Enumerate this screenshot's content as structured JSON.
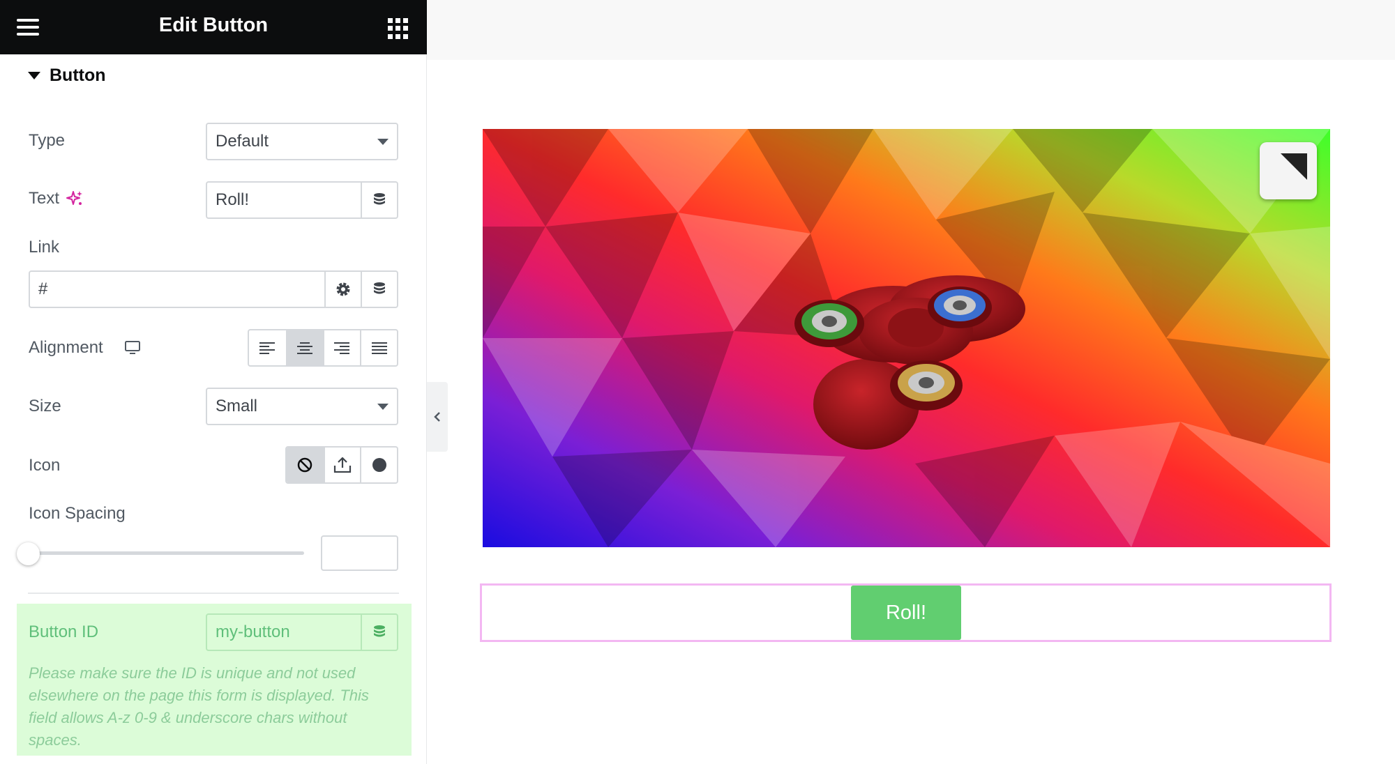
{
  "panel": {
    "title": "Edit Button",
    "section_title": "Button"
  },
  "controls": {
    "type": {
      "label": "Type",
      "value": "Default"
    },
    "text": {
      "label": "Text",
      "value": "Roll!"
    },
    "link": {
      "label": "Link",
      "value": "#"
    },
    "alignment": {
      "label": "Alignment",
      "options": [
        "left",
        "center",
        "right",
        "justify"
      ],
      "selected": "center"
    },
    "size": {
      "label": "Size",
      "value": "Small"
    },
    "icon": {
      "label": "Icon",
      "options": [
        "none",
        "upload",
        "circle"
      ],
      "selected": "none"
    },
    "icon_spacing": {
      "label": "Icon Spacing",
      "value": ""
    },
    "button_id": {
      "label": "Button ID",
      "value": "my-button",
      "help": "Please make sure the ID is unique and not used elsewhere on the page this form is displayed. This field allows A-z  0-9 & underscore chars without spaces."
    }
  },
  "canvas": {
    "button_label": "Roll!"
  },
  "colors": {
    "header_bg": "#0c0d0e",
    "accent_pink": "#d4249f",
    "button_green": "#61ce70",
    "selection_outline": "#f3b7f2",
    "button_id_bg": "#dcfcd8"
  }
}
